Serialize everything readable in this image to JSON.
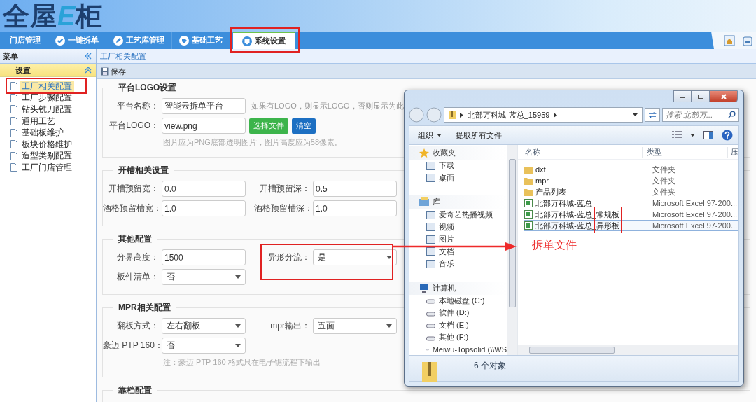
{
  "logo": {
    "before": "全屋",
    "mark": "E",
    "after": "柜"
  },
  "tabs": [
    {
      "label": "门店管理",
      "selected": false
    },
    {
      "label": "一键拆单",
      "selected": false
    },
    {
      "label": "工艺库管理",
      "selected": false
    },
    {
      "label": "基础工艺",
      "selected": false
    },
    {
      "label": "系统设置",
      "selected": true
    }
  ],
  "sidebar": {
    "title": "菜单",
    "section": {
      "title": "设置",
      "expanded": true
    },
    "items": [
      {
        "label": "工厂相关配置",
        "selected": true
      },
      {
        "label": "工厂步骤配置",
        "selected": false
      },
      {
        "label": "钻头铣刀配置",
        "selected": false
      },
      {
        "label": "通用工艺",
        "selected": false
      },
      {
        "label": "基础板维护",
        "selected": false
      },
      {
        "label": "板块价格维护",
        "selected": false
      },
      {
        "label": "造型类别配置",
        "selected": false
      },
      {
        "label": "工厂门店管理",
        "selected": false
      }
    ]
  },
  "breadcrumb": "工厂相关配置",
  "toolbar": {
    "save": "保存"
  },
  "sections": [
    {
      "title": "平台LOGO设置",
      "rows": [
        {
          "cells": [
            {
              "kind": "input",
              "label": "平台名称：",
              "value": "智能云拆单平台"
            },
            {
              "kind": "hint",
              "text": "如果有LOGO，则显示LOGO，否则显示为此"
            }
          ]
        },
        {
          "cells": [
            {
              "kind": "input",
              "label": "平台LOGO：",
              "value": "view.png"
            },
            {
              "kind": "button",
              "label": "选择文件",
              "color": "#3cb44b"
            },
            {
              "kind": "button",
              "label": "清空",
              "color": "#1c6fc2"
            }
          ]
        },
        {
          "cells": [
            {
              "kind": "note",
              "text": "图片应为PNG底部透明图片，图片高度应为58像素。"
            }
          ]
        }
      ]
    },
    {
      "title": "开槽相关设置",
      "rows": [
        {
          "cells": [
            {
              "kind": "input",
              "label": "开槽预留宽：",
              "value": "0.0"
            },
            {
              "kind": "input",
              "label": "开槽预留深：",
              "value": "0.5"
            }
          ]
        },
        {
          "cells": [
            {
              "kind": "input",
              "label": "酒格预留槽宽：",
              "value": "1.0"
            },
            {
              "kind": "input",
              "label": "酒格预留槽深：",
              "value": "1.0"
            }
          ]
        }
      ]
    },
    {
      "title": "其他配置",
      "rows": [
        {
          "cells": [
            {
              "kind": "input",
              "label": "分界高度：",
              "value": "1500"
            },
            {
              "kind": "select",
              "label": "异形分流：",
              "value": "是"
            }
          ]
        },
        {
          "cells": [
            {
              "kind": "select",
              "label": "板件清单：",
              "value": "否"
            }
          ]
        }
      ]
    },
    {
      "title": "MPR相关配置",
      "rows": [
        {
          "cells": [
            {
              "kind": "select",
              "label": "翻板方式：",
              "value": "左右翻板"
            },
            {
              "kind": "select",
              "label": "mpr输出：",
              "value": "五面"
            }
          ]
        },
        {
          "cells": [
            {
              "kind": "select",
              "label": "豪迈 PTP 160：",
              "value": "否"
            }
          ]
        },
        {
          "cells": [
            {
              "kind": "note",
              "text": "注：豪迈 PTP 160 格式只在电子锯流程下输出"
            }
          ]
        }
      ]
    },
    {
      "title": "靠档配置"
    }
  ],
  "explorer": {
    "path": "北部万科城-蓝总_15959",
    "search_placeholder": "搜索 北部万...",
    "commands": [
      {
        "label": "组织",
        "menu": true
      },
      {
        "label": "提取所有文件",
        "menu": false
      }
    ],
    "nav": [
      {
        "label": "收藏夹",
        "children": [
          {
            "label": "下载"
          },
          {
            "label": "桌面"
          }
        ]
      },
      {
        "label": "库",
        "children": [
          {
            "label": "爱奇艺热播视频"
          },
          {
            "label": "视频"
          },
          {
            "label": "图片"
          },
          {
            "label": "文档"
          },
          {
            "label": "音乐"
          }
        ]
      },
      {
        "label": "计算机",
        "children": [
          {
            "label": "本地磁盘 (C:)"
          },
          {
            "label": "软件 (D:)"
          },
          {
            "label": "文档 (E:)"
          },
          {
            "label": "其他 (F:)"
          },
          {
            "label": "Meiwu-Topsolid (\\\\WS"
          }
        ]
      }
    ],
    "columns": [
      "名称",
      "类型",
      "压"
    ],
    "files": [
      {
        "name": "dxf",
        "type": "文件夹",
        "kind": "folder",
        "selected": false
      },
      {
        "name": "mpr",
        "type": "文件夹",
        "kind": "folder",
        "selected": false
      },
      {
        "name": "产品列表",
        "type": "文件夹",
        "kind": "folder",
        "selected": false
      },
      {
        "name": "北部万科城-蓝总",
        "type": "Microsoft Excel 97-200...",
        "kind": "spreadsheet",
        "selected": false
      },
      {
        "name": "北部万科城-蓝总_常规板",
        "type": "Microsoft Excel 97-200...",
        "kind": "spreadsheet",
        "selected": false
      },
      {
        "name": "北部万科城-蓝总_异形板",
        "type": "Microsoft Excel 97-200...",
        "kind": "spreadsheet",
        "selected": true
      }
    ],
    "status": "6 个对象"
  },
  "annotation": {
    "label": "拆单文件"
  }
}
